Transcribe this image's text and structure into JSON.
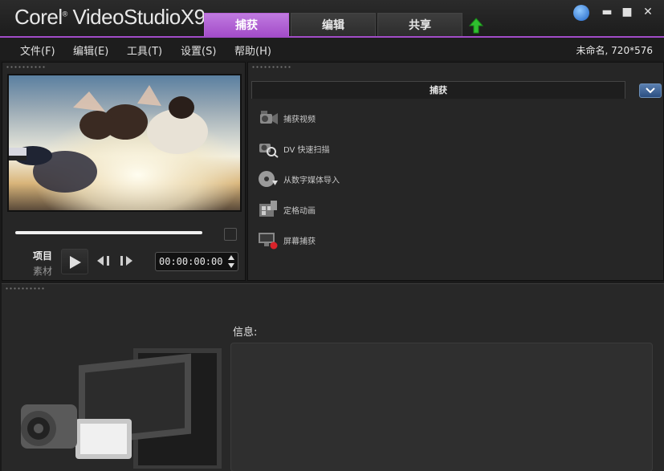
{
  "titlebar": {
    "app_name": "Corel",
    "app_product": "VideoStudio",
    "app_version": "X9",
    "tabs": [
      {
        "label": "捕获",
        "active": true
      },
      {
        "label": "编辑",
        "active": false
      },
      {
        "label": "共享",
        "active": false
      }
    ],
    "window_controls": {
      "minimize": "▬",
      "maximize": "■",
      "close": "✕"
    },
    "accent_color": "#a24cc8"
  },
  "menubar": {
    "items": [
      "文件(F)",
      "编辑(E)",
      "工具(T)",
      "设置(S)",
      "帮助(H)"
    ],
    "project_info": "未命名, 720*576"
  },
  "player": {
    "mode_project": "项目",
    "mode_clip": "素材",
    "timecode": "00:00:00:00"
  },
  "capture": {
    "header": "捕获",
    "options": [
      {
        "label": "捕获视频",
        "icon": "camcorder-icon"
      },
      {
        "label": "DV 快速扫描",
        "icon": "dv-scan-icon"
      },
      {
        "label": "从数字媒体导入",
        "icon": "disc-import-icon"
      },
      {
        "label": "定格动画",
        "icon": "stop-motion-icon"
      },
      {
        "label": "屏幕捕获",
        "icon": "screen-capture-icon"
      }
    ]
  },
  "info": {
    "label": "信息:"
  }
}
